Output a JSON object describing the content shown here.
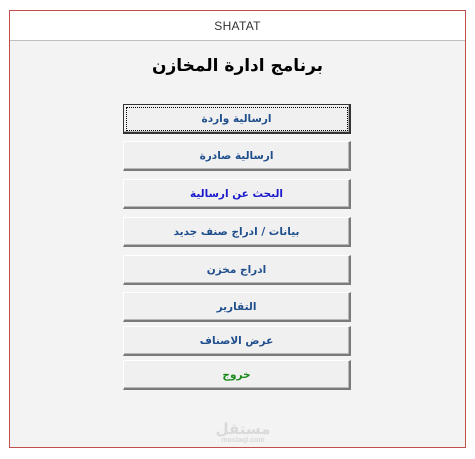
{
  "window": {
    "title": "SHATAT",
    "border_color": "#c0504d"
  },
  "heading": "برنامج ادارة المخازن",
  "buttons": [
    {
      "label": "ارسالية واردة",
      "color": "#1f4e8c",
      "focused": true
    },
    {
      "label": "ارسالية صادرة",
      "color": "#1f4e8c"
    },
    {
      "label": "البحث عن ارسالية",
      "color": "#1a1acc"
    },
    {
      "label": "بيانات / ادراج صنف جديد",
      "color": "#1f4e8c"
    },
    {
      "label": "ادراج مخزن",
      "color": "#1f4e8c"
    },
    {
      "label": "التقارير",
      "color": "#1f4e8c"
    },
    {
      "label": "عرض الاصناف",
      "color": "#1f4e8c"
    },
    {
      "label": "خروج",
      "color": "#1b8a1b"
    }
  ],
  "watermark": {
    "main": "مستقل",
    "sub": "mostaql.com"
  }
}
